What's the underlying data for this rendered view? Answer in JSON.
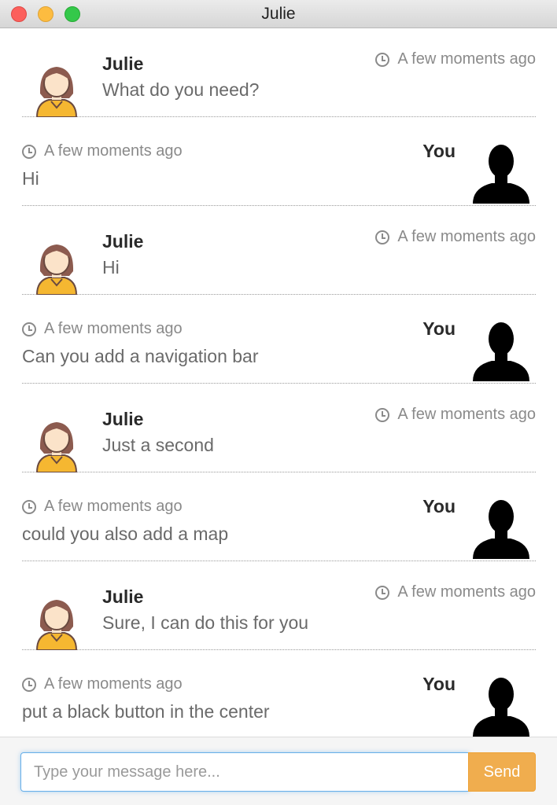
{
  "window": {
    "title": "Julie"
  },
  "messages": [
    {
      "author": "Julie",
      "time": "A few moments ago",
      "text": "What do you need?"
    },
    {
      "author": "You",
      "time": "A few moments ago",
      "text": "Hi"
    },
    {
      "author": "Julie",
      "time": "A few moments ago",
      "text": "Hi"
    },
    {
      "author": "You",
      "time": "A few moments ago",
      "text": "Can you add a navigation bar"
    },
    {
      "author": "Julie",
      "time": "A few moments ago",
      "text": "Just a second"
    },
    {
      "author": "You",
      "time": "A few moments ago",
      "text": "could you also add a map"
    },
    {
      "author": "Julie",
      "time": "A few moments ago",
      "text": "Sure, I can do this for you"
    },
    {
      "author": "You",
      "time": "A few moments ago",
      "text": "put a black button in the center"
    }
  ],
  "composer": {
    "placeholder": "Type your message here...",
    "send_label": "Send"
  },
  "colors": {
    "accent": "#f0ad4e",
    "focus": "#66afe9",
    "julie_shirt": "#f5b731",
    "julie_hair": "#8c5b4f"
  }
}
